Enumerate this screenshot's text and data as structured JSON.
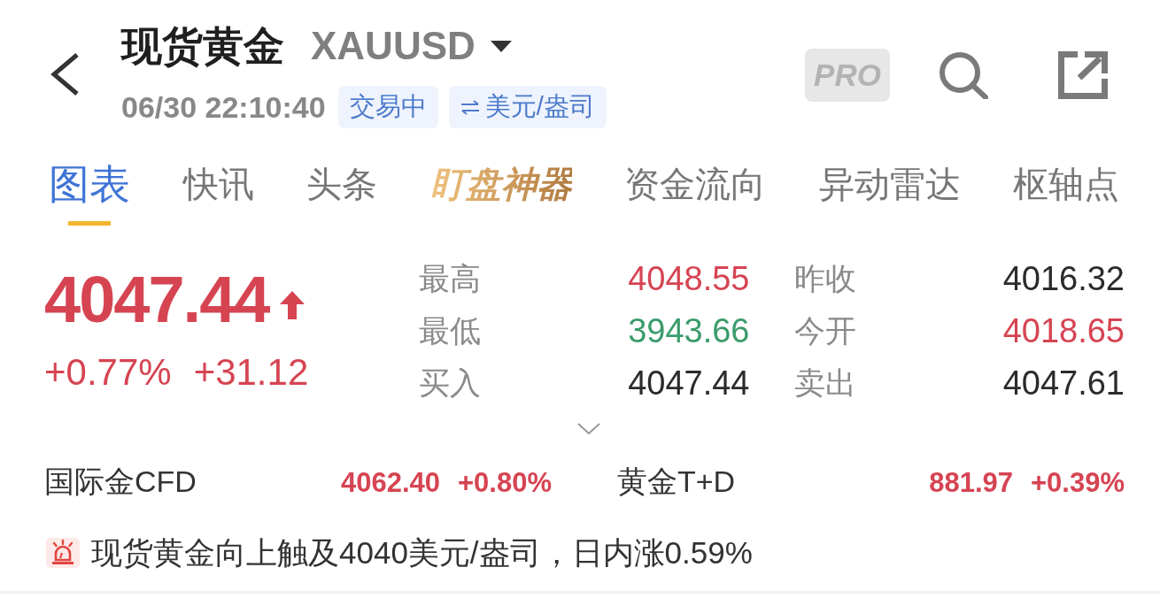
{
  "header": {
    "title": "现货黄金",
    "symbol": "XAUUSD",
    "time": "06/30 22:10:40",
    "status": "交易中",
    "unit": "美元/盎司",
    "pro": "PRO"
  },
  "tabs": [
    {
      "label": "图表",
      "selected": true,
      "kind": "plain"
    },
    {
      "label": "快讯",
      "selected": false,
      "kind": "plain"
    },
    {
      "label": "头条",
      "selected": false,
      "kind": "plain"
    },
    {
      "label": "盯盘神器",
      "selected": false,
      "kind": "featured"
    },
    {
      "label": "资金流向",
      "selected": false,
      "kind": "plain"
    },
    {
      "label": "异动雷达",
      "selected": false,
      "kind": "plain"
    },
    {
      "label": "枢轴点",
      "selected": false,
      "kind": "plain"
    }
  ],
  "quote": {
    "price": "4047.44",
    "rising": true,
    "change_percent": "+0.77%",
    "change": "+31.12",
    "stats": [
      {
        "label": "最高",
        "value": "4048.55",
        "color": "#d64452"
      },
      {
        "label": "昨收",
        "value": "4016.32",
        "color": "#2b2b2b"
      },
      {
        "label": "最低",
        "value": "3943.66",
        "color": "#3c9c6c"
      },
      {
        "label": "今开",
        "value": "4018.65",
        "color": "#d64452"
      },
      {
        "label": "买入",
        "value": "4047.44",
        "color": "#2b2b2b"
      },
      {
        "label": "卖出",
        "value": "4047.61",
        "color": "#2b2b2b"
      }
    ]
  },
  "related": [
    {
      "name": "国际金CFD",
      "price": "4062.40",
      "change": "+0.80%",
      "rising": true
    },
    {
      "name": "黄金T+D",
      "price": "881.97",
      "change": "+0.39%",
      "rising": true
    }
  ],
  "alert": {
    "text": "现货黄金向上触及4040美元/盎司，日内涨0.59%"
  }
}
